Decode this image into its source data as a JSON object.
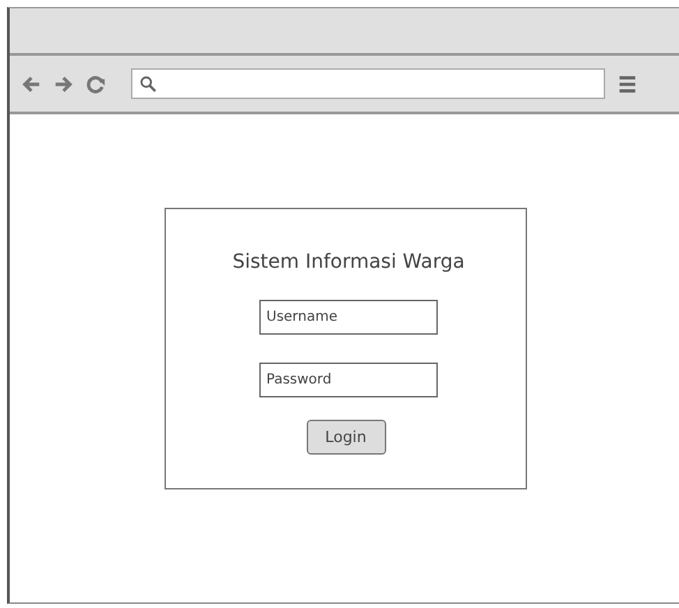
{
  "login": {
    "title": "Sistem Informasi Warga",
    "fields": [
      {
        "placeholder": "Username"
      },
      {
        "placeholder": "Password"
      }
    ],
    "button": "Login"
  }
}
